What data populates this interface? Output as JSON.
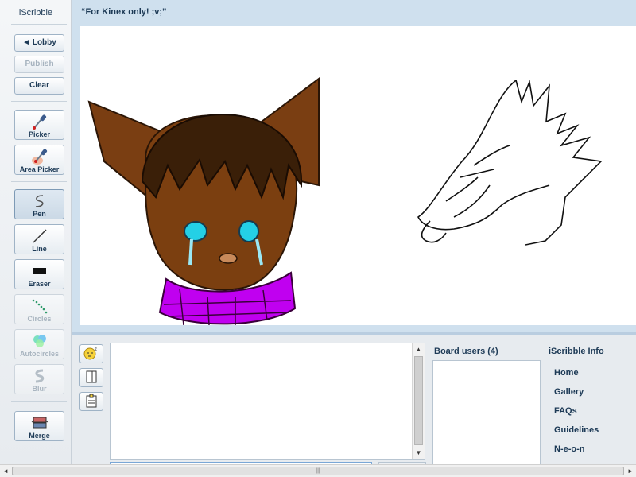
{
  "app": {
    "title": "iScribble"
  },
  "toolbar": {
    "lobby_label": "◄ Lobby",
    "publish_label": "Publish",
    "clear_label": "Clear",
    "tools": {
      "picker": "Picker",
      "area_picker": "Area Picker",
      "pen": "Pen",
      "line": "Line",
      "eraser": "Eraser",
      "circles": "Circles",
      "autocircles": "Autocircles",
      "blur": "Blur",
      "merge": "Merge"
    },
    "selected_tool": "Pen"
  },
  "board": {
    "title": "“For Kinex only! ;v;”"
  },
  "sidebar_panel": {
    "board_users_title": "Board users (4)",
    "info_title": "iScribble Info",
    "info_links": [
      "Home",
      "Gallery",
      "FAQs",
      "Guidelines",
      "N-e-o-n"
    ]
  },
  "colors": {
    "scarf": "#c000f0",
    "fur": "#6b3a12",
    "eyes": "#24d0e6",
    "accent": "#b9cde0"
  }
}
